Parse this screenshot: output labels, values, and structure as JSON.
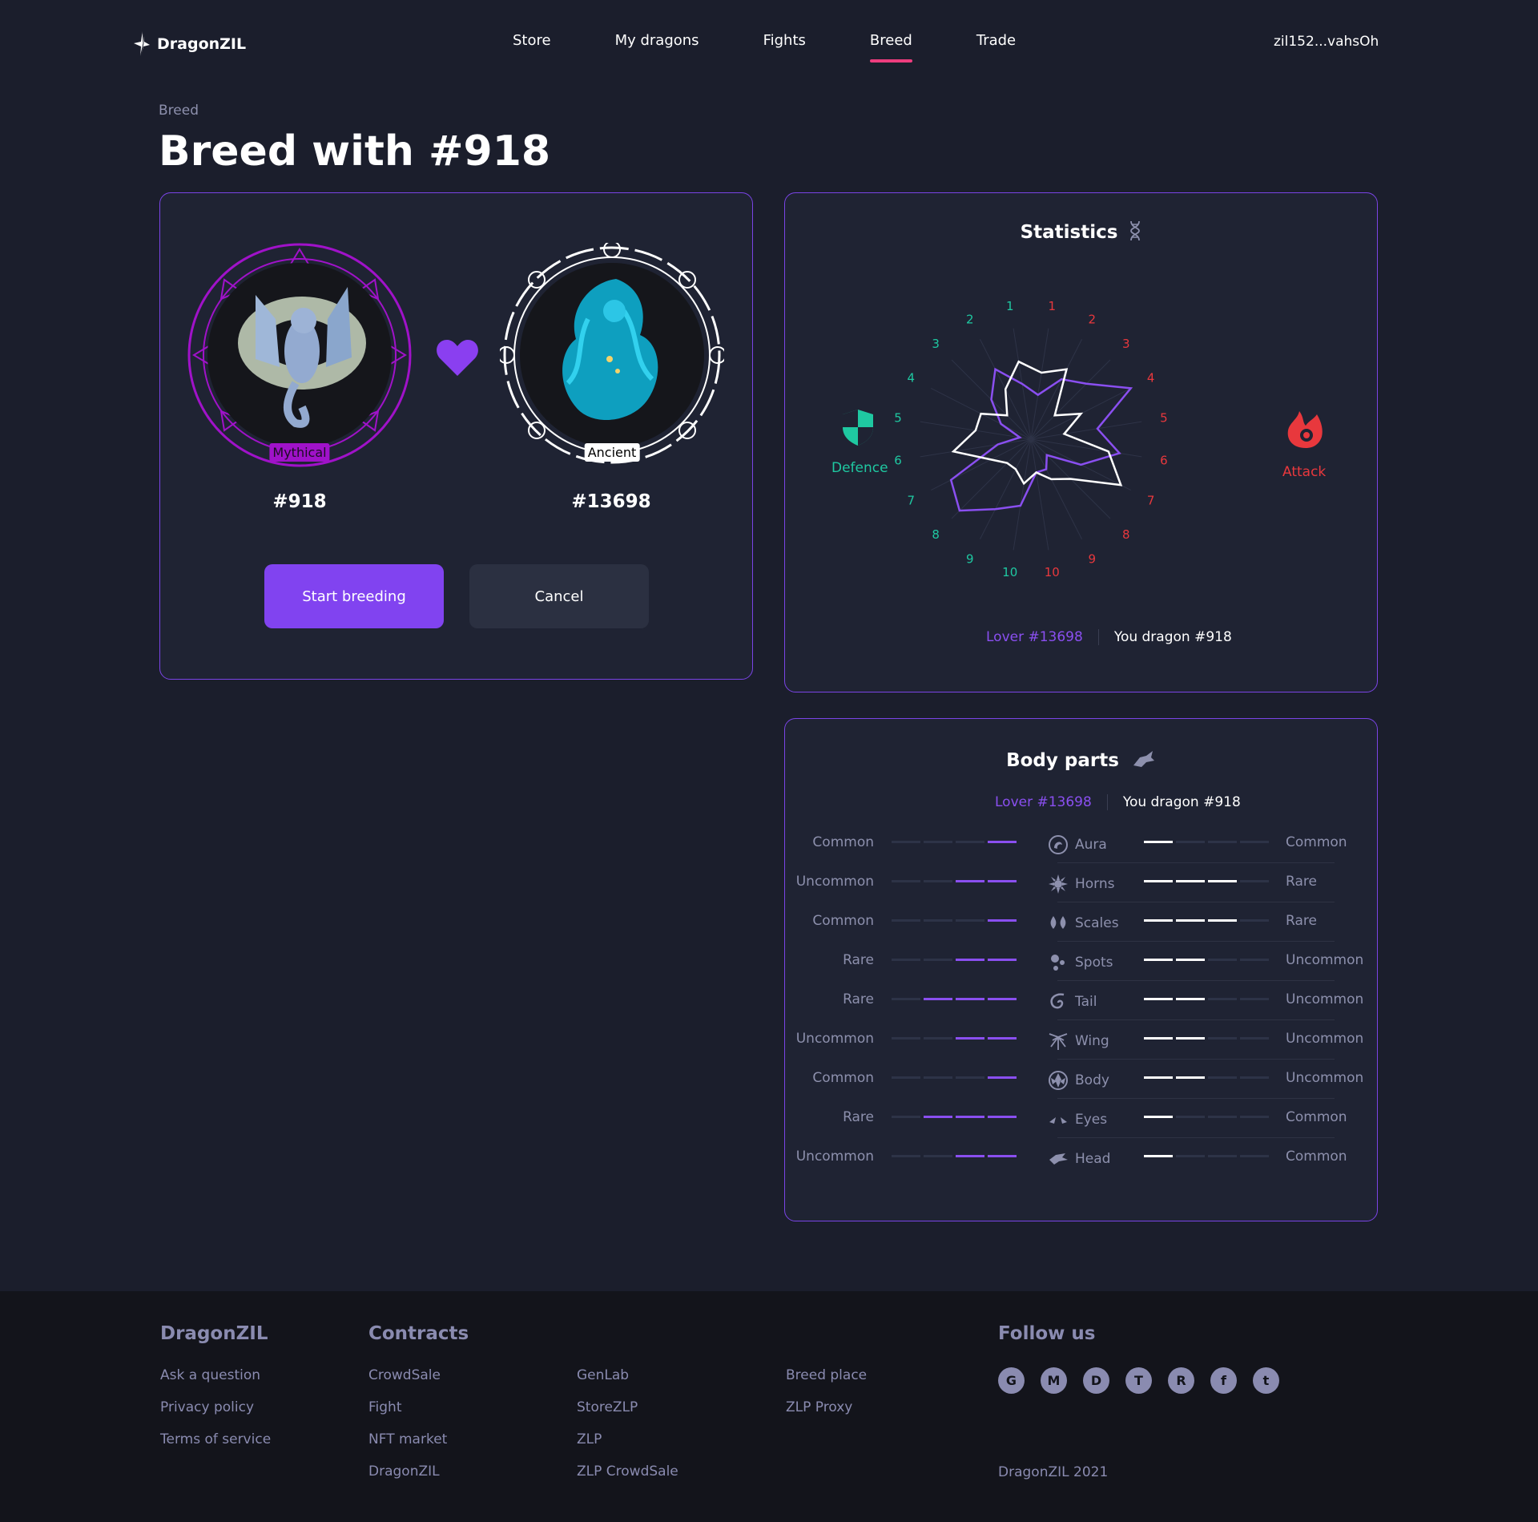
{
  "brand": {
    "name": "DragonZIL"
  },
  "nav": [
    {
      "label": "Store",
      "active": false
    },
    {
      "label": "My dragons",
      "active": false
    },
    {
      "label": "Fights",
      "active": false
    },
    {
      "label": "Breed",
      "active": true
    },
    {
      "label": "Trade",
      "active": false
    }
  ],
  "wallet": "zil152...vahsOh",
  "breadcrumb": "Breed",
  "page_title": "Breed with #918",
  "breed": {
    "left": {
      "id": "#918",
      "rarity": "Mythical"
    },
    "right": {
      "id": "#13698",
      "rarity": "Ancient"
    },
    "start_label": "Start breeding",
    "cancel_label": "Cancel"
  },
  "statistics": {
    "title": "Statistics",
    "defence_label": "Defence",
    "attack_label": "Attack",
    "legend_lover": "Lover #13698",
    "legend_you": "You dragon #918",
    "defence_ticks": [
      "10",
      "9",
      "8",
      "7",
      "6",
      "5",
      "4",
      "3",
      "2",
      "1"
    ],
    "attack_ticks": [
      "1",
      "2",
      "3",
      "4",
      "5",
      "6",
      "7",
      "8",
      "9",
      "10"
    ],
    "series_lover": [
      4,
      6,
      7,
      10,
      6,
      8,
      5,
      2,
      3,
      3,
      6,
      7,
      9,
      8,
      3,
      1,
      3,
      5,
      7,
      5
    ],
    "series_you": [
      6,
      7,
      3,
      5,
      3,
      7,
      9,
      5,
      4,
      3,
      4,
      3,
      3,
      4,
      7,
      5,
      5,
      3,
      5,
      7
    ],
    "colors": {
      "lover": "#8a4ff0",
      "you": "#ffffff",
      "defence": "#1fc8a1",
      "attack": "#e8383d"
    }
  },
  "body_parts": {
    "title": "Body parts",
    "legend_lover": "Lover #13698",
    "legend_you": "You dragon #918",
    "rows": [
      {
        "name": "Aura",
        "icon": "aura-icon",
        "left_rarity": "Common",
        "left_level": 1,
        "right_rarity": "Common",
        "right_level": 1
      },
      {
        "name": "Horns",
        "icon": "horns-icon",
        "left_rarity": "Uncommon",
        "left_level": 2,
        "right_rarity": "Rare",
        "right_level": 3
      },
      {
        "name": "Scales",
        "icon": "scales-icon",
        "left_rarity": "Common",
        "left_level": 1,
        "right_rarity": "Rare",
        "right_level": 3
      },
      {
        "name": "Spots",
        "icon": "spots-icon",
        "left_rarity": "Rare",
        "left_level": 2,
        "right_rarity": "Uncommon",
        "right_level": 2
      },
      {
        "name": "Tail",
        "icon": "tail-icon",
        "left_rarity": "Rare",
        "left_level": 3,
        "right_rarity": "Uncommon",
        "right_level": 2
      },
      {
        "name": "Wing",
        "icon": "wing-icon",
        "left_rarity": "Uncommon",
        "left_level": 2,
        "right_rarity": "Uncommon",
        "right_level": 2
      },
      {
        "name": "Body",
        "icon": "body-icon",
        "left_rarity": "Common",
        "left_level": 1,
        "right_rarity": "Uncommon",
        "right_level": 2
      },
      {
        "name": "Eyes",
        "icon": "eyes-icon",
        "left_rarity": "Rare",
        "left_level": 3,
        "right_rarity": "Common",
        "right_level": 1
      },
      {
        "name": "Head",
        "icon": "head-icon",
        "left_rarity": "Uncommon",
        "left_level": 2,
        "right_rarity": "Common",
        "right_level": 1
      }
    ]
  },
  "footer": {
    "brand_heading": "DragonZIL",
    "brand_links": [
      "Ask a question",
      "Privacy policy",
      "Terms of service"
    ],
    "contracts_heading": "Contracts",
    "contracts_col1": [
      "CrowdSale",
      "Fight",
      "NFT market",
      "DragonZIL"
    ],
    "contracts_col2": [
      "GenLab",
      "StoreZLP",
      "ZLP",
      "ZLP CrowdSale"
    ],
    "contracts_col3": [
      "Breed place",
      "ZLP Proxy"
    ],
    "follow_heading": "Follow us",
    "social": [
      "github-icon",
      "medium-icon",
      "discord-icon",
      "telegram-icon",
      "reddit-icon",
      "facebook-icon",
      "twitter-icon"
    ],
    "social_glyphs": [
      "G",
      "M",
      "D",
      "T",
      "R",
      "f",
      "t"
    ],
    "copyright": "DragonZIL  2021"
  }
}
